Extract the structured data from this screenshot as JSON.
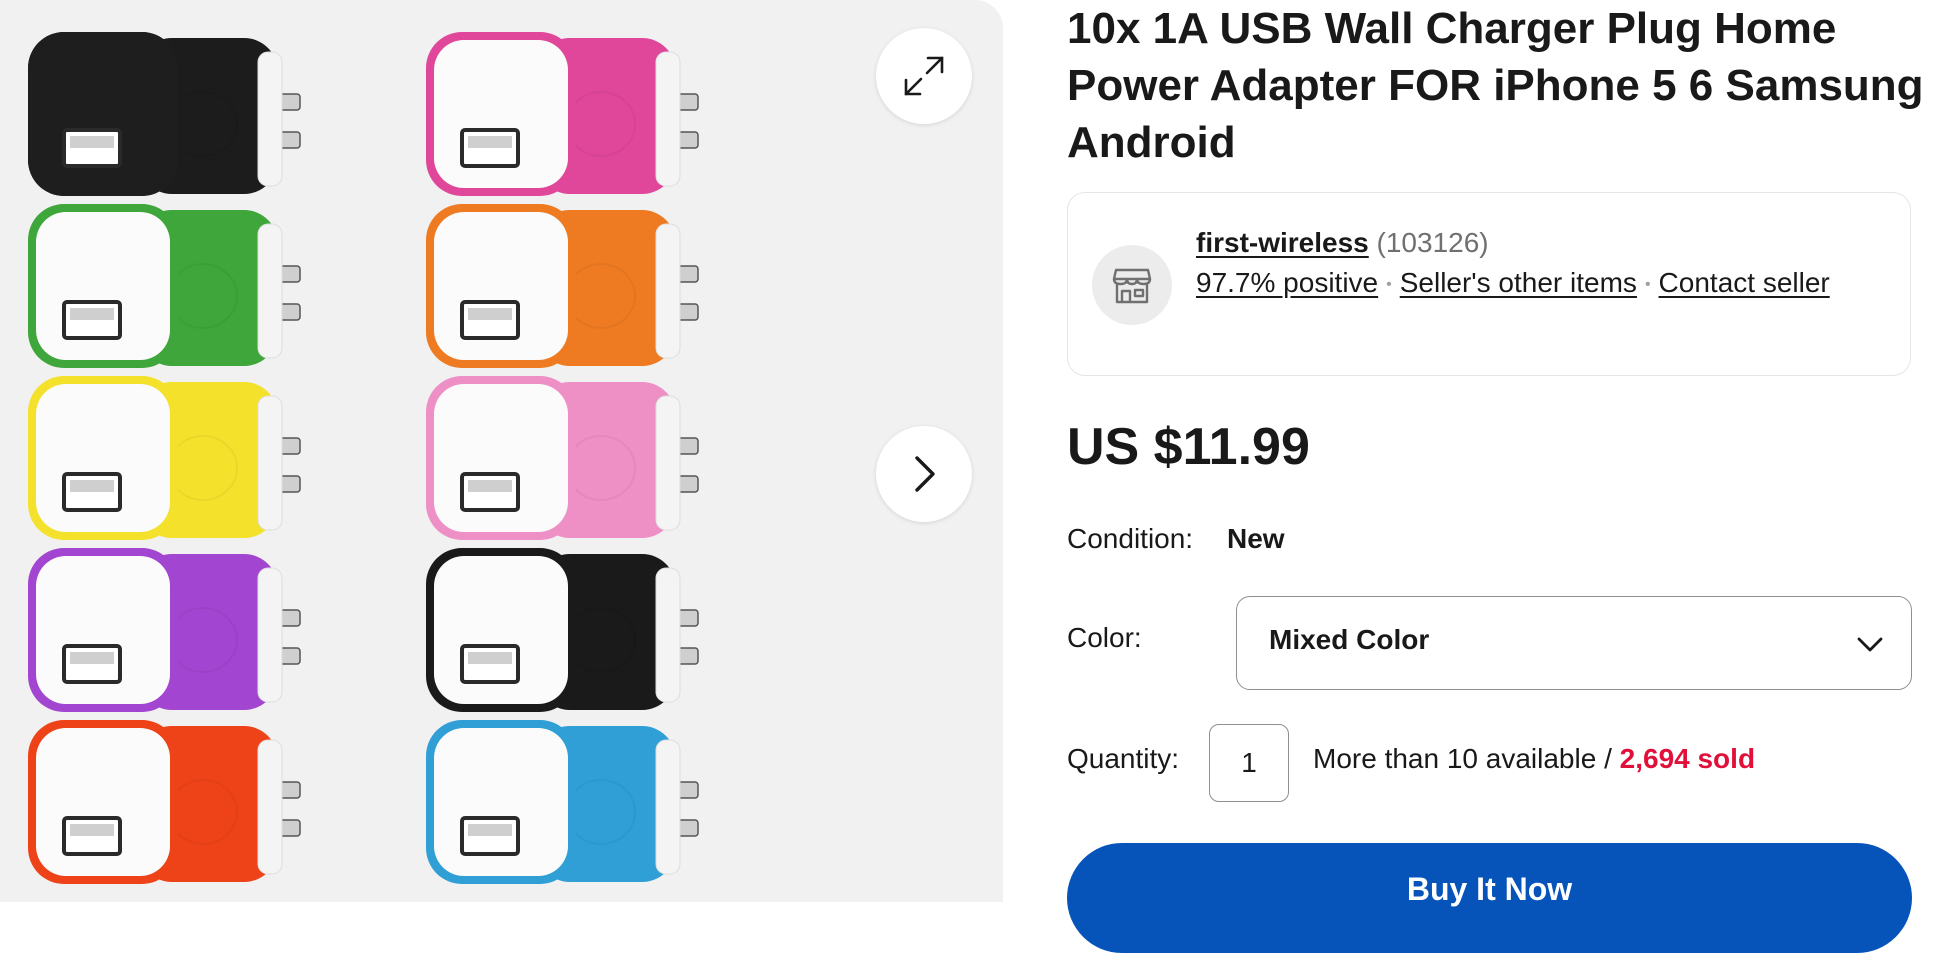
{
  "product": {
    "title": "10x 1A USB Wall Charger Plug Home Power Adapter FOR iPhone 5 6 Samsung Android",
    "price": "US $11.99"
  },
  "gallery": {
    "expand_icon": "expand-arrows-icon",
    "next_icon": "chevron-right-icon",
    "charger_colors": [
      "#1c1c1c",
      "#e0479a",
      "#3ea63a",
      "#ee7b22",
      "#f4e12c",
      "#ee8fc6",
      "#a245d0",
      "#1a1a1a",
      "#ee4319",
      "#2f9fd6"
    ]
  },
  "seller": {
    "name": "first-wireless",
    "feedback_count": "(103126)",
    "positive": "97.7% positive",
    "other_items": "Seller's other items",
    "contact": "Contact seller",
    "icon": "store-icon"
  },
  "condition": {
    "label": "Condition:",
    "value": "New"
  },
  "color": {
    "label": "Color:",
    "value": "Mixed Color",
    "icon": "chevron-down-icon"
  },
  "quantity": {
    "label": "Quantity:",
    "value": "1",
    "available": "More than 10 available / ",
    "sold": "2,694 sold"
  },
  "actions": {
    "buy_now": "Buy It Now"
  },
  "colors": {
    "primary_blue": "#0654ba",
    "sold_red": "#e0103a"
  }
}
